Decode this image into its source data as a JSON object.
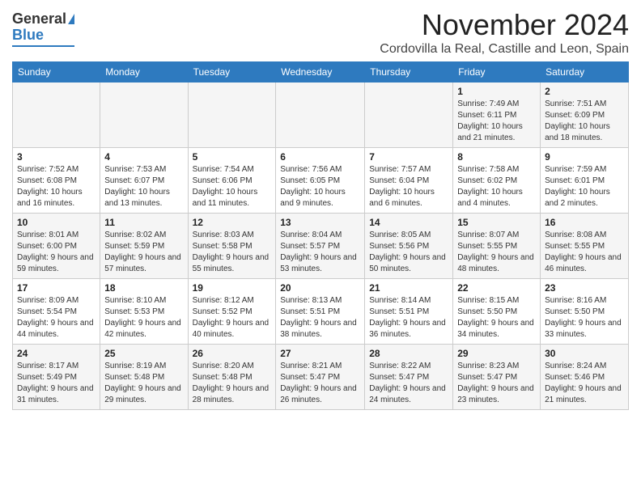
{
  "header": {
    "logo_line1": "General",
    "logo_line2": "Blue",
    "month": "November 2024",
    "location": "Cordovilla la Real, Castille and Leon, Spain"
  },
  "days_of_week": [
    "Sunday",
    "Monday",
    "Tuesday",
    "Wednesday",
    "Thursday",
    "Friday",
    "Saturday"
  ],
  "weeks": [
    [
      {
        "day": "",
        "info": ""
      },
      {
        "day": "",
        "info": ""
      },
      {
        "day": "",
        "info": ""
      },
      {
        "day": "",
        "info": ""
      },
      {
        "day": "",
        "info": ""
      },
      {
        "day": "1",
        "info": "Sunrise: 7:49 AM\nSunset: 6:11 PM\nDaylight: 10 hours and 21 minutes."
      },
      {
        "day": "2",
        "info": "Sunrise: 7:51 AM\nSunset: 6:09 PM\nDaylight: 10 hours and 18 minutes."
      }
    ],
    [
      {
        "day": "3",
        "info": "Sunrise: 7:52 AM\nSunset: 6:08 PM\nDaylight: 10 hours and 16 minutes."
      },
      {
        "day": "4",
        "info": "Sunrise: 7:53 AM\nSunset: 6:07 PM\nDaylight: 10 hours and 13 minutes."
      },
      {
        "day": "5",
        "info": "Sunrise: 7:54 AM\nSunset: 6:06 PM\nDaylight: 10 hours and 11 minutes."
      },
      {
        "day": "6",
        "info": "Sunrise: 7:56 AM\nSunset: 6:05 PM\nDaylight: 10 hours and 9 minutes."
      },
      {
        "day": "7",
        "info": "Sunrise: 7:57 AM\nSunset: 6:04 PM\nDaylight: 10 hours and 6 minutes."
      },
      {
        "day": "8",
        "info": "Sunrise: 7:58 AM\nSunset: 6:02 PM\nDaylight: 10 hours and 4 minutes."
      },
      {
        "day": "9",
        "info": "Sunrise: 7:59 AM\nSunset: 6:01 PM\nDaylight: 10 hours and 2 minutes."
      }
    ],
    [
      {
        "day": "10",
        "info": "Sunrise: 8:01 AM\nSunset: 6:00 PM\nDaylight: 9 hours and 59 minutes."
      },
      {
        "day": "11",
        "info": "Sunrise: 8:02 AM\nSunset: 5:59 PM\nDaylight: 9 hours and 57 minutes."
      },
      {
        "day": "12",
        "info": "Sunrise: 8:03 AM\nSunset: 5:58 PM\nDaylight: 9 hours and 55 minutes."
      },
      {
        "day": "13",
        "info": "Sunrise: 8:04 AM\nSunset: 5:57 PM\nDaylight: 9 hours and 53 minutes."
      },
      {
        "day": "14",
        "info": "Sunrise: 8:05 AM\nSunset: 5:56 PM\nDaylight: 9 hours and 50 minutes."
      },
      {
        "day": "15",
        "info": "Sunrise: 8:07 AM\nSunset: 5:55 PM\nDaylight: 9 hours and 48 minutes."
      },
      {
        "day": "16",
        "info": "Sunrise: 8:08 AM\nSunset: 5:55 PM\nDaylight: 9 hours and 46 minutes."
      }
    ],
    [
      {
        "day": "17",
        "info": "Sunrise: 8:09 AM\nSunset: 5:54 PM\nDaylight: 9 hours and 44 minutes."
      },
      {
        "day": "18",
        "info": "Sunrise: 8:10 AM\nSunset: 5:53 PM\nDaylight: 9 hours and 42 minutes."
      },
      {
        "day": "19",
        "info": "Sunrise: 8:12 AM\nSunset: 5:52 PM\nDaylight: 9 hours and 40 minutes."
      },
      {
        "day": "20",
        "info": "Sunrise: 8:13 AM\nSunset: 5:51 PM\nDaylight: 9 hours and 38 minutes."
      },
      {
        "day": "21",
        "info": "Sunrise: 8:14 AM\nSunset: 5:51 PM\nDaylight: 9 hours and 36 minutes."
      },
      {
        "day": "22",
        "info": "Sunrise: 8:15 AM\nSunset: 5:50 PM\nDaylight: 9 hours and 34 minutes."
      },
      {
        "day": "23",
        "info": "Sunrise: 8:16 AM\nSunset: 5:50 PM\nDaylight: 9 hours and 33 minutes."
      }
    ],
    [
      {
        "day": "24",
        "info": "Sunrise: 8:17 AM\nSunset: 5:49 PM\nDaylight: 9 hours and 31 minutes."
      },
      {
        "day": "25",
        "info": "Sunrise: 8:19 AM\nSunset: 5:48 PM\nDaylight: 9 hours and 29 minutes."
      },
      {
        "day": "26",
        "info": "Sunrise: 8:20 AM\nSunset: 5:48 PM\nDaylight: 9 hours and 28 minutes."
      },
      {
        "day": "27",
        "info": "Sunrise: 8:21 AM\nSunset: 5:47 PM\nDaylight: 9 hours and 26 minutes."
      },
      {
        "day": "28",
        "info": "Sunrise: 8:22 AM\nSunset: 5:47 PM\nDaylight: 9 hours and 24 minutes."
      },
      {
        "day": "29",
        "info": "Sunrise: 8:23 AM\nSunset: 5:47 PM\nDaylight: 9 hours and 23 minutes."
      },
      {
        "day": "30",
        "info": "Sunrise: 8:24 AM\nSunset: 5:46 PM\nDaylight: 9 hours and 21 minutes."
      }
    ]
  ]
}
